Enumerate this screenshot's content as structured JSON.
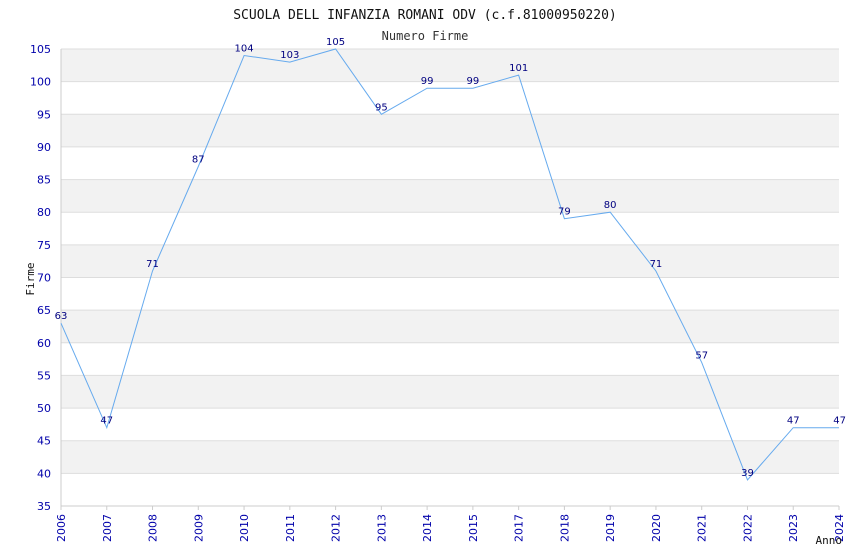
{
  "chart_data": {
    "type": "line",
    "title": "SCUOLA DELL INFANZIA ROMANI ODV (c.f.81000950220)",
    "subtitle": "Numero Firme",
    "xlabel": "Anno",
    "ylabel": "Firme",
    "ylim": [
      35,
      105
    ],
    "yticks": [
      35,
      40,
      45,
      50,
      55,
      60,
      65,
      70,
      75,
      80,
      85,
      90,
      95,
      100,
      105
    ],
    "x": [
      "2006",
      "2007",
      "2008",
      "2009",
      "2010",
      "2011",
      "2012",
      "2013",
      "2014",
      "2015",
      "2017",
      "2018",
      "2019",
      "2020",
      "2021",
      "2022",
      "2023",
      "2024"
    ],
    "values": [
      63,
      47,
      71,
      87,
      104,
      103,
      105,
      95,
      99,
      99,
      101,
      79,
      80,
      71,
      57,
      39,
      47,
      47
    ],
    "grid": true,
    "colors": {
      "line": "#66aaee",
      "band": "#f2f2f2",
      "tick_text": "#0000aa",
      "data_label": "#000080"
    }
  }
}
